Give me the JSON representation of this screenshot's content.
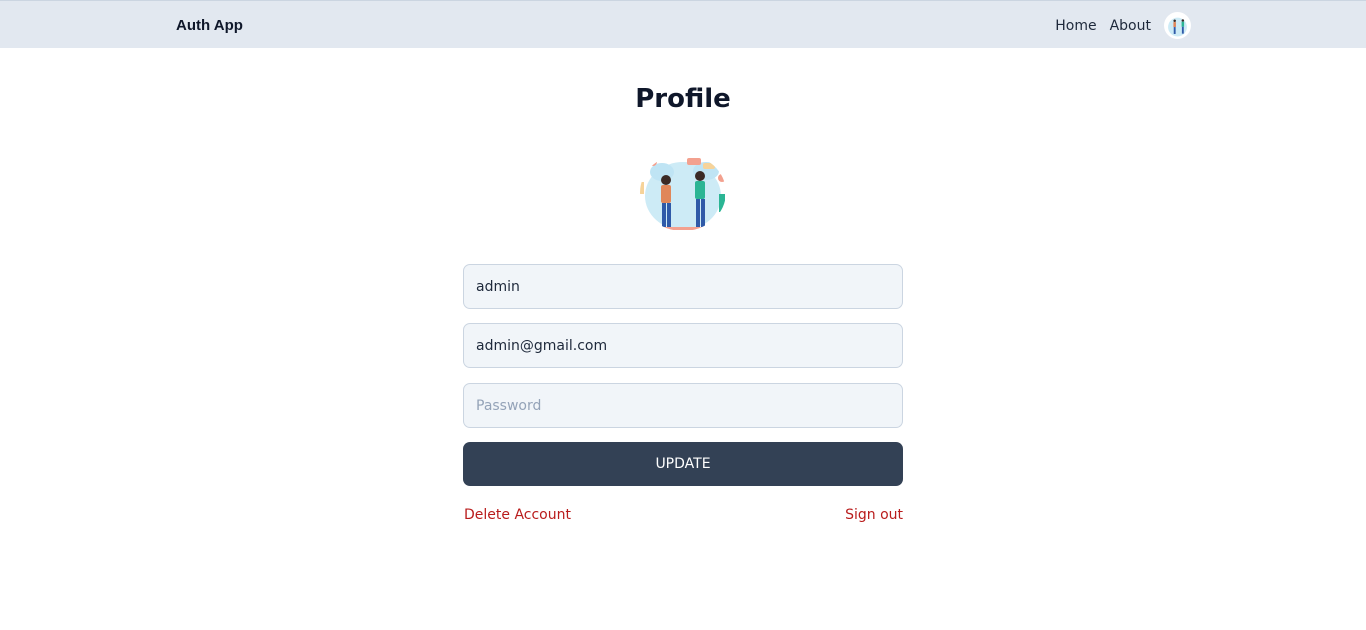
{
  "navbar": {
    "brand": "Auth App",
    "links": [
      {
        "label": "Home"
      },
      {
        "label": "About"
      }
    ],
    "avatar_icon": "user-avatar-illustration"
  },
  "profile": {
    "title": "Profile",
    "avatar_icon": "profile-illustration",
    "username_value": "admin",
    "email_value": "admin@gmail.com",
    "password_value": "",
    "password_placeholder": "Password",
    "update_label": "UPDATE",
    "delete_label": "Delete Account",
    "signout_label": "Sign out"
  },
  "colors": {
    "navbar_bg": "#e2e8f0",
    "button_bg": "#334155",
    "danger": "#b91c1c",
    "field_bg": "#f1f5f9"
  }
}
